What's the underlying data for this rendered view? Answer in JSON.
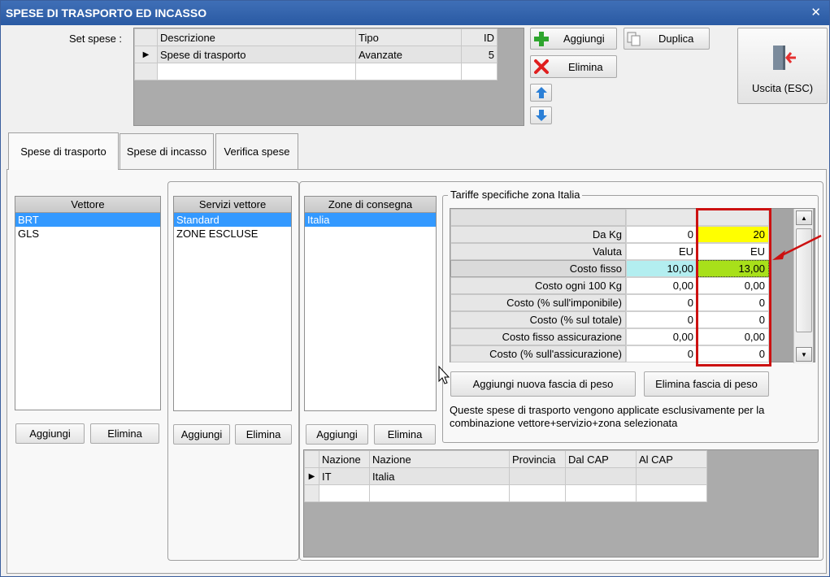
{
  "window": {
    "title": "SPESE DI TRASPORTO ED INCASSO",
    "close_symbol": "✕"
  },
  "set_spese": {
    "label": "Set spese :",
    "columns": [
      "Descrizione",
      "Tipo",
      "ID"
    ],
    "rows": [
      {
        "descrizione": "Spese di trasporto",
        "tipo": "Avanzate",
        "id": "5"
      }
    ]
  },
  "toolbar": {
    "aggiungi": "Aggiungi",
    "duplica": "Duplica",
    "elimina": "Elimina",
    "uscita": "Uscita (ESC)"
  },
  "tabs": [
    "Spese di trasporto",
    "Spese di incasso",
    "Verifica spese"
  ],
  "vettore": {
    "header": "Vettore",
    "items": [
      "BRT",
      "GLS"
    ],
    "add": "Aggiungi",
    "remove": "Elimina"
  },
  "servizi": {
    "header": "Servizi vettore",
    "items": [
      "Standard",
      "ZONE ESCLUSE"
    ],
    "add": "Aggiungi",
    "remove": "Elimina"
  },
  "zone": {
    "header": "Zone di consegna",
    "items": [
      "Italia"
    ],
    "add": "Aggiungi",
    "remove": "Elimina"
  },
  "tariffe": {
    "group_title": "Tariffe specifiche zona Italia",
    "rows": [
      {
        "label": "Da Kg",
        "v1": "0",
        "v2": "20"
      },
      {
        "label": "Valuta",
        "v1": "EU",
        "v2": "EU"
      },
      {
        "label": "Costo fisso",
        "v1": "10,00",
        "v2": "13,00"
      },
      {
        "label": "Costo ogni 100 Kg",
        "v1": "0,00",
        "v2": "0,00"
      },
      {
        "label": "Costo (% sull'imponibile)",
        "v1": "0",
        "v2": "0"
      },
      {
        "label": "Costo (% sul totale)",
        "v1": "0",
        "v2": "0"
      },
      {
        "label": "Costo fisso assicurazione",
        "v1": "0,00",
        "v2": "0,00"
      },
      {
        "label": "Costo (% sull'assicurazione)",
        "v1": "0",
        "v2": "0"
      }
    ],
    "add_band": "Aggiungi nuova fascia di peso",
    "remove_band": "Elimina fascia di peso",
    "note": "Queste spese di trasporto vengono applicate esclusivamente per la combinazione vettore+servizio+zona selezionata"
  },
  "nazioni": {
    "columns": [
      "Nazione",
      "Nazione",
      "Provincia",
      "Dal CAP",
      "Al CAP"
    ],
    "rows": [
      {
        "code": "IT",
        "name": "Italia",
        "provincia": "",
        "dal_cap": "",
        "al_cap": ""
      }
    ]
  },
  "colors": {
    "title_bar": "#2f62ad",
    "selection": "#3399ff",
    "highlight_yellow": "#ffff00",
    "highlight_green": "#a8e01a",
    "highlight_cyan": "#b3eef0",
    "annotation_red": "#cc1111"
  }
}
